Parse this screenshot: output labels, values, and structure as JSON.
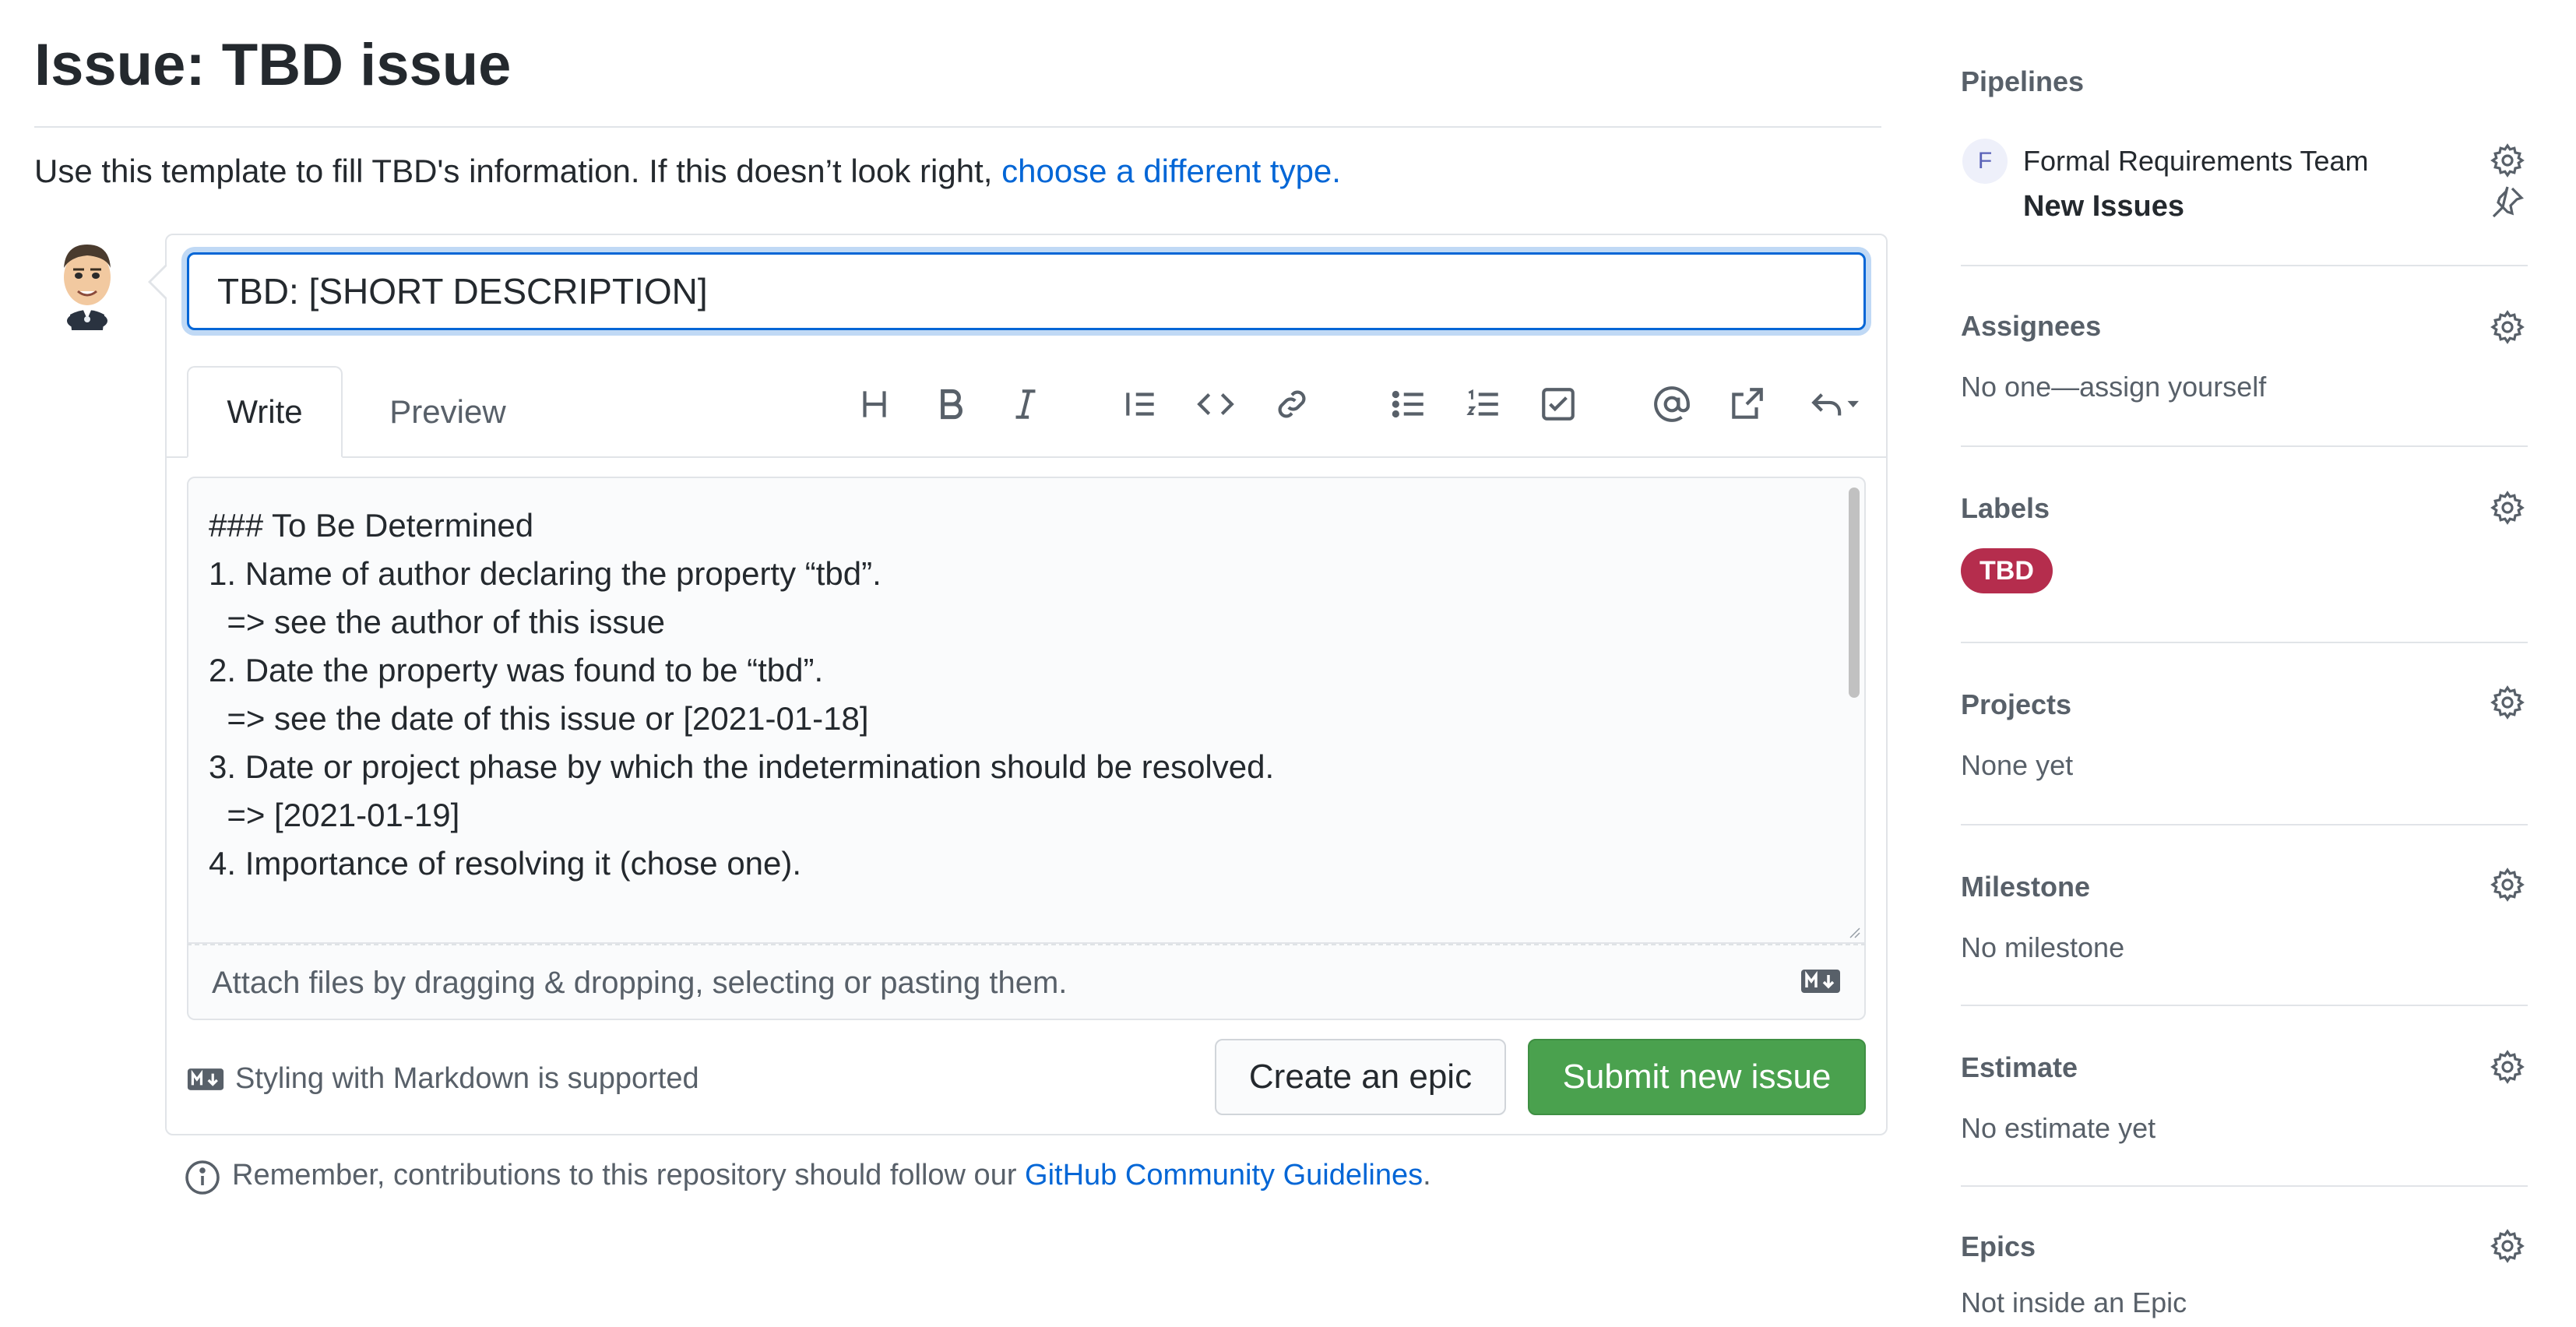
{
  "page": {
    "title": "Issue: TBD issue",
    "intro_text": "Use this template to fill TBD's information. If this doesn’t look right, ",
    "intro_link": "choose a different type."
  },
  "form": {
    "title_value": "TBD: [SHORT DESCRIPTION]",
    "tabs": [
      {
        "label": "Write",
        "active": true
      },
      {
        "label": "Preview",
        "active": false
      }
    ],
    "toolbar_icons": [
      "heading-icon",
      "bold-icon",
      "italic-icon",
      "quote-icon",
      "code-icon",
      "link-icon",
      "bulleted-list-icon",
      "numbered-list-icon",
      "task-list-icon",
      "mention-icon",
      "cross-reference-icon",
      "saved-reply-icon"
    ],
    "body_lines": [
      "### To Be Determined",
      "",
      "1. Name of author declaring the property “tbd”.",
      "  => see the author of this issue",
      "2. Date the property was found to be “tbd”.",
      "  => see the date of this issue or [2021-01-18]",
      "3. Date or project phase by which the indetermination should be resolved.",
      "  => [2021-01-19]",
      "4. Importance of resolving it (chose one)."
    ],
    "attach_text": "Attach files by dragging & dropping, selecting or pasting them.",
    "markdown_note": "Styling with Markdown is supported",
    "create_epic_label": "Create an epic",
    "submit_label": "Submit new issue",
    "guidelines_prefix": "Remember, contributions to this repository should follow our ",
    "guidelines_link": "GitHub Community Guidelines",
    "guidelines_suffix": "."
  },
  "sidebar": {
    "pipelines": {
      "heading": "Pipelines",
      "team_initial": "F",
      "team": "Formal Requirements Team",
      "stage": "New Issues"
    },
    "assignees": {
      "heading": "Assignees",
      "value": "No one—assign yourself"
    },
    "labels": {
      "heading": "Labels",
      "items": [
        {
          "name": "TBD",
          "color": "#b52d4d"
        }
      ]
    },
    "projects": {
      "heading": "Projects",
      "value": "None yet"
    },
    "milestone": {
      "heading": "Milestone",
      "value": "No milestone"
    },
    "estimate": {
      "heading": "Estimate",
      "value": "No estimate yet"
    },
    "epics": {
      "heading": "Epics",
      "value": "Not inside an Epic"
    }
  },
  "colors": {
    "link": "#0366d6",
    "submit_button": "#4aa14e",
    "label_tbd": "#b52d4d"
  }
}
